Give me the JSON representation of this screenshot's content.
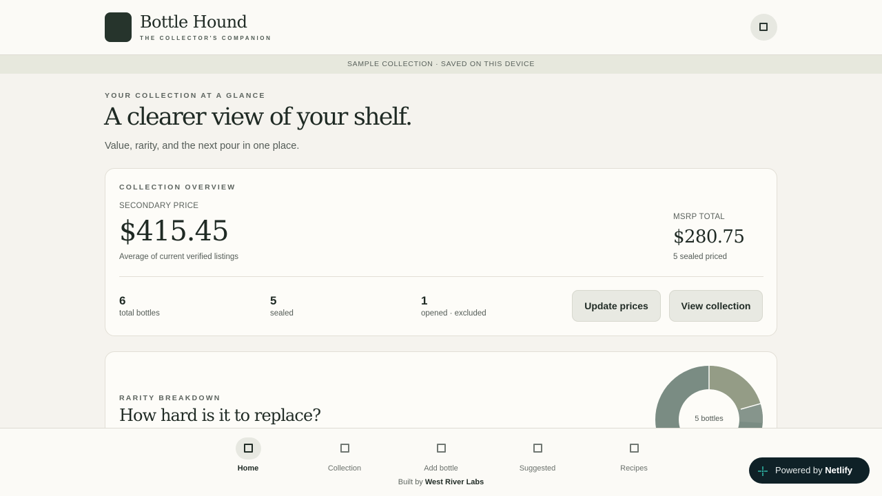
{
  "header": {
    "brand_name": "Bottle Hound",
    "brand_tagline": "THE COLLECTOR'S COMPANION",
    "action_icon": "square-icon"
  },
  "banner": {
    "text": "SAMPLE COLLECTION · SAVED ON THIS DEVICE"
  },
  "hero": {
    "eyebrow": "YOUR COLLECTION AT A GLANCE",
    "title": "A clearer view of your shelf.",
    "subtitle": "Value, rarity, and the next pour in one place."
  },
  "overview": {
    "eyebrow": "COLLECTION OVERVIEW",
    "secondary_label": "SECONDARY PRICE",
    "secondary_value": "$415.45",
    "secondary_note": "Average of current verified listings",
    "msrp_label": "MSRP TOTAL",
    "msrp_value": "$280.75",
    "msrp_note": "5 sealed priced",
    "stats": [
      {
        "value": "6",
        "label": "total bottles"
      },
      {
        "value": "5",
        "label": "sealed"
      },
      {
        "value": "1",
        "label": "opened · excluded"
      }
    ],
    "update_button": "Update prices",
    "view_button": "View collection"
  },
  "rarity": {
    "eyebrow": "RARITY BREAKDOWN",
    "title": "How hard is it to replace?",
    "donut_center": "5 bottles",
    "colors": {
      "primary": "#7a8c83",
      "secondary": "#949c86",
      "accent": "#86958c"
    }
  },
  "nav": {
    "items": [
      {
        "label": "Home",
        "active": true
      },
      {
        "label": "Collection",
        "active": false
      },
      {
        "label": "Add bottle",
        "active": false
      },
      {
        "label": "Suggested",
        "active": false
      },
      {
        "label": "Recipes",
        "active": false
      }
    ],
    "built_by_prefix": "Built by",
    "built_by_name": "West River Labs"
  },
  "badge": {
    "prefix": "Powered by",
    "name": "Netlify"
  },
  "theme": {
    "background": "#f5f3ee",
    "surface": "#fdfcf8",
    "ink": "#1f2a24",
    "accent_dark": "#26342c",
    "badge_bg": "#0f2127"
  }
}
